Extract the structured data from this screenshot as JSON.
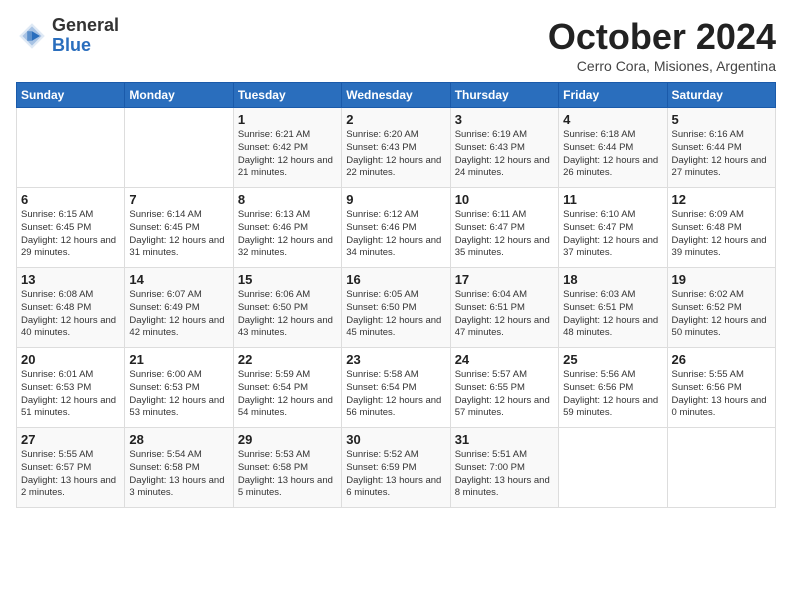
{
  "logo": {
    "general": "General",
    "blue": "Blue"
  },
  "title": "October 2024",
  "subtitle": "Cerro Cora, Misiones, Argentina",
  "days_header": [
    "Sunday",
    "Monday",
    "Tuesday",
    "Wednesday",
    "Thursday",
    "Friday",
    "Saturday"
  ],
  "weeks": [
    [
      {
        "num": "",
        "info": ""
      },
      {
        "num": "",
        "info": ""
      },
      {
        "num": "1",
        "info": "Sunrise: 6:21 AM\nSunset: 6:42 PM\nDaylight: 12 hours and 21 minutes."
      },
      {
        "num": "2",
        "info": "Sunrise: 6:20 AM\nSunset: 6:43 PM\nDaylight: 12 hours and 22 minutes."
      },
      {
        "num": "3",
        "info": "Sunrise: 6:19 AM\nSunset: 6:43 PM\nDaylight: 12 hours and 24 minutes."
      },
      {
        "num": "4",
        "info": "Sunrise: 6:18 AM\nSunset: 6:44 PM\nDaylight: 12 hours and 26 minutes."
      },
      {
        "num": "5",
        "info": "Sunrise: 6:16 AM\nSunset: 6:44 PM\nDaylight: 12 hours and 27 minutes."
      }
    ],
    [
      {
        "num": "6",
        "info": "Sunrise: 6:15 AM\nSunset: 6:45 PM\nDaylight: 12 hours and 29 minutes."
      },
      {
        "num": "7",
        "info": "Sunrise: 6:14 AM\nSunset: 6:45 PM\nDaylight: 12 hours and 31 minutes."
      },
      {
        "num": "8",
        "info": "Sunrise: 6:13 AM\nSunset: 6:46 PM\nDaylight: 12 hours and 32 minutes."
      },
      {
        "num": "9",
        "info": "Sunrise: 6:12 AM\nSunset: 6:46 PM\nDaylight: 12 hours and 34 minutes."
      },
      {
        "num": "10",
        "info": "Sunrise: 6:11 AM\nSunset: 6:47 PM\nDaylight: 12 hours and 35 minutes."
      },
      {
        "num": "11",
        "info": "Sunrise: 6:10 AM\nSunset: 6:47 PM\nDaylight: 12 hours and 37 minutes."
      },
      {
        "num": "12",
        "info": "Sunrise: 6:09 AM\nSunset: 6:48 PM\nDaylight: 12 hours and 39 minutes."
      }
    ],
    [
      {
        "num": "13",
        "info": "Sunrise: 6:08 AM\nSunset: 6:48 PM\nDaylight: 12 hours and 40 minutes."
      },
      {
        "num": "14",
        "info": "Sunrise: 6:07 AM\nSunset: 6:49 PM\nDaylight: 12 hours and 42 minutes."
      },
      {
        "num": "15",
        "info": "Sunrise: 6:06 AM\nSunset: 6:50 PM\nDaylight: 12 hours and 43 minutes."
      },
      {
        "num": "16",
        "info": "Sunrise: 6:05 AM\nSunset: 6:50 PM\nDaylight: 12 hours and 45 minutes."
      },
      {
        "num": "17",
        "info": "Sunrise: 6:04 AM\nSunset: 6:51 PM\nDaylight: 12 hours and 47 minutes."
      },
      {
        "num": "18",
        "info": "Sunrise: 6:03 AM\nSunset: 6:51 PM\nDaylight: 12 hours and 48 minutes."
      },
      {
        "num": "19",
        "info": "Sunrise: 6:02 AM\nSunset: 6:52 PM\nDaylight: 12 hours and 50 minutes."
      }
    ],
    [
      {
        "num": "20",
        "info": "Sunrise: 6:01 AM\nSunset: 6:53 PM\nDaylight: 12 hours and 51 minutes."
      },
      {
        "num": "21",
        "info": "Sunrise: 6:00 AM\nSunset: 6:53 PM\nDaylight: 12 hours and 53 minutes."
      },
      {
        "num": "22",
        "info": "Sunrise: 5:59 AM\nSunset: 6:54 PM\nDaylight: 12 hours and 54 minutes."
      },
      {
        "num": "23",
        "info": "Sunrise: 5:58 AM\nSunset: 6:54 PM\nDaylight: 12 hours and 56 minutes."
      },
      {
        "num": "24",
        "info": "Sunrise: 5:57 AM\nSunset: 6:55 PM\nDaylight: 12 hours and 57 minutes."
      },
      {
        "num": "25",
        "info": "Sunrise: 5:56 AM\nSunset: 6:56 PM\nDaylight: 12 hours and 59 minutes."
      },
      {
        "num": "26",
        "info": "Sunrise: 5:55 AM\nSunset: 6:56 PM\nDaylight: 13 hours and 0 minutes."
      }
    ],
    [
      {
        "num": "27",
        "info": "Sunrise: 5:55 AM\nSunset: 6:57 PM\nDaylight: 13 hours and 2 minutes."
      },
      {
        "num": "28",
        "info": "Sunrise: 5:54 AM\nSunset: 6:58 PM\nDaylight: 13 hours and 3 minutes."
      },
      {
        "num": "29",
        "info": "Sunrise: 5:53 AM\nSunset: 6:58 PM\nDaylight: 13 hours and 5 minutes."
      },
      {
        "num": "30",
        "info": "Sunrise: 5:52 AM\nSunset: 6:59 PM\nDaylight: 13 hours and 6 minutes."
      },
      {
        "num": "31",
        "info": "Sunrise: 5:51 AM\nSunset: 7:00 PM\nDaylight: 13 hours and 8 minutes."
      },
      {
        "num": "",
        "info": ""
      },
      {
        "num": "",
        "info": ""
      }
    ]
  ]
}
